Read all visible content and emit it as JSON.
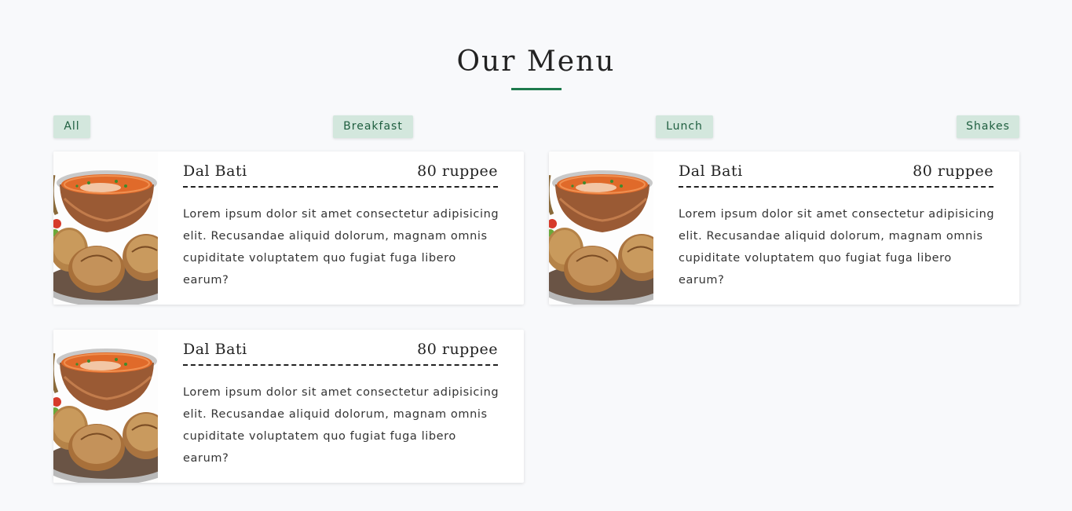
{
  "section": {
    "title": "Our Menu",
    "accent_color": "#1e7a4c"
  },
  "filters": [
    {
      "label": "All"
    },
    {
      "label": "Breakfast"
    },
    {
      "label": "Lunch"
    },
    {
      "label": "Shakes"
    }
  ],
  "menu_items": [
    {
      "name": "Dal Bati",
      "price": "80 ruppee",
      "description": "Lorem ipsum dolor sit amet consectetur adipisicing elit. Recusandae aliquid dolorum, magnam omnis cupiditate voluptatem quo fugiat fuga libero earum?",
      "image_icon": "dal-bati-photo"
    },
    {
      "name": "Dal Bati",
      "price": "80 ruppee",
      "description": "Lorem ipsum dolor sit amet consectetur adipisicing elit. Recusandae aliquid dolorum, magnam omnis cupiditate voluptatem quo fugiat fuga libero earum?",
      "image_icon": "dal-bati-photo"
    },
    {
      "name": "Dal Bati",
      "price": "80 ruppee",
      "description": "Lorem ipsum dolor sit amet consectetur adipisicing elit. Recusandae aliquid dolorum, magnam omnis cupiditate voluptatem quo fugiat fuga libero earum?",
      "image_icon": "dal-bati-photo"
    }
  ]
}
